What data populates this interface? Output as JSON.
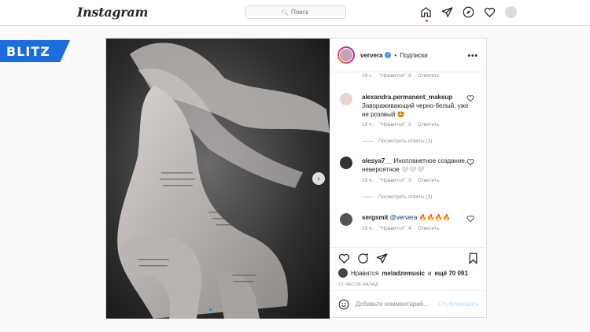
{
  "topbar": {
    "logo": "Instagram",
    "search_placeholder": "Поиск"
  },
  "overlay": {
    "brand": "BLITZ",
    "brand_color": "#1b6cde"
  },
  "post": {
    "author": "ververa",
    "follow_label": "Подписки",
    "more_label": "•••",
    "carousel": {
      "total_slides": 4,
      "active_slide": 1
    },
    "comments": [
      {
        "meta_time": "19 ч.",
        "meta_likes": "\"Нравится\": 8",
        "meta_reply": "Ответить"
      },
      {
        "user": "alexandra.permanent_makeup",
        "text": "Завораживающий черно-белый, уже не розовый 🤩",
        "meta_time": "19 ч.",
        "meta_likes": "\"Нравится\": 6",
        "meta_reply": "Ответить",
        "replies": "Посмотреть ответы (1)"
      },
      {
        "user": "olesya7__",
        "text": "Инопланетное создание, невероятное 🤍🤍🤍",
        "meta_time": "19 ч.",
        "meta_likes": "\"Нравится\": 5",
        "meta_reply": "Ответить",
        "replies": "Посмотреть ответы (1)"
      },
      {
        "user": "sergsmit",
        "mention": "@ververa",
        "text": "🔥🔥🔥🔥",
        "meta_time": "19 ч.",
        "meta_likes": "\"Нравится\": 4",
        "meta_reply": "Ответить"
      }
    ],
    "likes": {
      "prefix": "Нравится",
      "user": "meladzemusic",
      "and": "и",
      "others": "ещё 70 091"
    },
    "timestamp": "19 ЧАСОВ НАЗАД",
    "add_comment_placeholder": "Добавьте комментарий...",
    "publish_label": "Опубликовать"
  },
  "icons": [
    "home-icon",
    "direct-icon",
    "explore-icon",
    "heart-icon",
    "like-icon",
    "comment-icon",
    "share-icon",
    "bookmark-icon",
    "emoji-icon",
    "search-icon"
  ]
}
